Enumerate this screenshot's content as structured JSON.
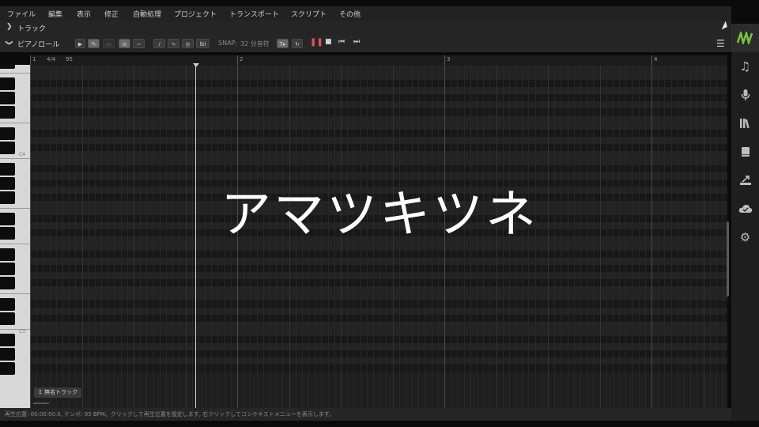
{
  "menu": [
    "ファイル",
    "編集",
    "表示",
    "修正",
    "自動処理",
    "プロジェクト",
    "トランスポート",
    "スクリプト",
    "その他"
  ],
  "track_row": {
    "label": "トラック"
  },
  "piano_row": {
    "label": "ピアノロール"
  },
  "toolbar": {
    "snap_label": "SNAP:",
    "snap_value": "32 分音符",
    "tool_lbl": "lbl"
  },
  "ruler": {
    "time_signature": "4/4",
    "tempo": "95",
    "measures": [
      "1",
      "2",
      "3",
      "4"
    ]
  },
  "keys": {
    "c4": "C4",
    "c3": "C3"
  },
  "track_chip": {
    "label": "無名トラック"
  },
  "status": {
    "text": "再生位置: 00:00:00.0, テンポ: 95 BPM。クリックして再生位置を設定します, 右クリックしてコンテキストメニューを表示します。"
  },
  "overlay": {
    "title": "アマツキツネ"
  },
  "sidebar": {
    "icons": [
      "logo-icon",
      "music-note-icon",
      "microphone-icon",
      "library-icon",
      "book-icon",
      "export-icon",
      "cloud-icon",
      "gear-icon"
    ]
  },
  "colors": {
    "accent": "#7cc242",
    "record": "#e0505a",
    "background": "#1f1f1f"
  }
}
